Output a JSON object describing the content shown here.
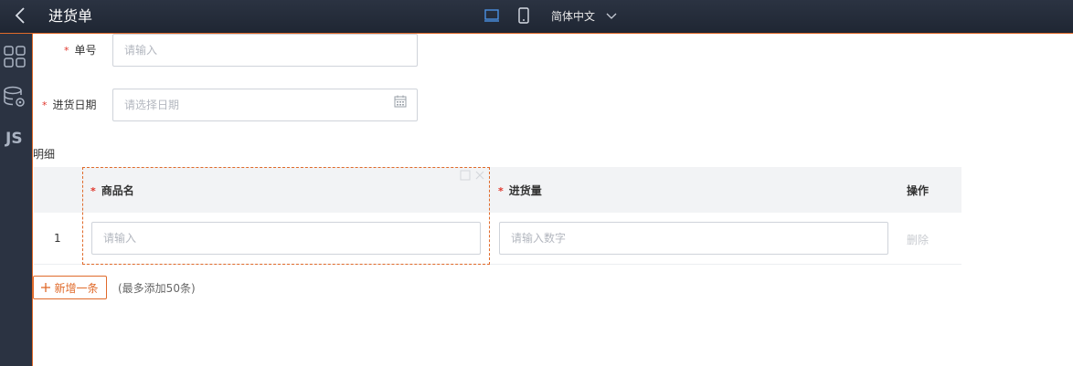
{
  "header": {
    "title": "进货单",
    "language": "简体中文",
    "icons": [
      "back-icon",
      "desktop-icon",
      "mobile-icon",
      "chevron-down-icon"
    ],
    "colors": {
      "bar": "#2b3342",
      "accent": "#e06a2a"
    }
  },
  "sidebar": {
    "items": [
      {
        "icon": "grid-icon"
      },
      {
        "icon": "database-settings-icon"
      },
      {
        "icon": "js-icon",
        "label": "JS"
      }
    ]
  },
  "form": {
    "order_no": {
      "label": "单号",
      "placeholder": "请输入",
      "required": true
    },
    "date": {
      "label": "进货日期",
      "placeholder": "请选择日期",
      "required": true,
      "icon": "calendar-icon"
    }
  },
  "detail": {
    "title": "明细",
    "columns": [
      {
        "label": "商品名",
        "required": true
      },
      {
        "label": "进货量",
        "required": true
      },
      {
        "label": "操作",
        "required": false
      }
    ],
    "rows": [
      {
        "index": "1",
        "name_placeholder": "请输入",
        "qty_placeholder": "请输入数字",
        "action": "删除"
      }
    ],
    "add_button": "新增一条",
    "add_icon": "plus-icon",
    "add_hint": "(最多添加50条)"
  }
}
